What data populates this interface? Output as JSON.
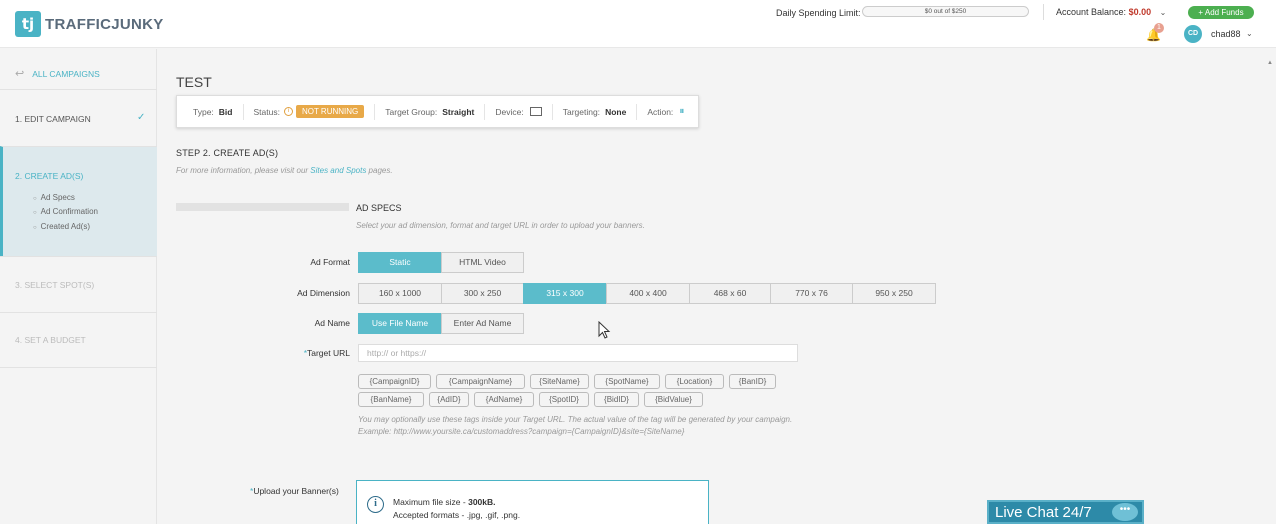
{
  "header": {
    "logo_mark": "tj",
    "logo_text": "TRAFFICJUNKY",
    "spending_label": "Daily Spending Limit:",
    "spending_bar_text": "$0 out of $250",
    "balance_label": "Account Balance:",
    "balance_value": "$0.00",
    "add_funds": "+ Add Funds",
    "notification_count": "1",
    "avatar_initials": "CD",
    "username": "chad88"
  },
  "sidebar": {
    "back_label": "ALL CAMPAIGNS",
    "steps": [
      {
        "label": "1. EDIT CAMPAIGN",
        "state": "done"
      },
      {
        "label": "2. CREATE AD(S)",
        "state": "active"
      },
      {
        "label": "3. SELECT SPOT(S)",
        "state": "disabled"
      },
      {
        "label": "4. SET A BUDGET",
        "state": "disabled"
      }
    ],
    "substeps": [
      "Ad Specs",
      "Ad Confirmation",
      "Created Ad(s)"
    ]
  },
  "main": {
    "title": "TEST",
    "info": {
      "type_label": "Type:",
      "type_value": "Bid",
      "status_label": "Status:",
      "status_value": "NOT RUNNING",
      "target_group_label": "Target Group:",
      "target_group_value": "Straight",
      "device_label": "Device:",
      "targeting_label": "Targeting:",
      "targeting_value": "None",
      "action_label": "Action:"
    },
    "step_heading": "STEP 2. CREATE AD(S)",
    "step_info_prefix": "For more information, please visit our ",
    "step_info_link": "Sites and Spots",
    "step_info_suffix": " pages.",
    "specs_title": "AD SPECS",
    "specs_subtitle": "Select your ad dimension, format and target URL in order to upload your banners.",
    "ad_format_label": "Ad Format",
    "ad_formats": [
      "Static",
      "HTML Video"
    ],
    "ad_dimension_label": "Ad Dimension",
    "ad_dimensions": [
      "160 x 1000",
      "300 x 250",
      "315 x 300",
      "400 x 400",
      "468 x 60",
      "770 x 76",
      "950 x 250"
    ],
    "ad_name_label": "Ad Name",
    "ad_name_options": [
      "Use File Name",
      "Enter Ad Name"
    ],
    "target_url_label": "Target URL",
    "target_url_placeholder": "http:// or https://",
    "tags": [
      "{CampaignID}",
      "{CampaignName}",
      "{SiteName}",
      "{SpotName}",
      "{Location}",
      "{BanID}",
      "{BanName}",
      "{AdID}",
      "{AdName}",
      "{SpotID}",
      "{BidID}",
      "{BidValue}"
    ],
    "tag_help_line1": "You may optionally use these tags inside your Target URL. The actual value of the tag will be generated by your campaign.",
    "tag_help_line2": "Example: http://www.yoursite.ca/customaddress?campaign={CampaignID}&site={SiteName}",
    "upload_label": "Upload your Banner(s)",
    "upload_max_label": "Maximum file size - ",
    "upload_max_value": "300kB.",
    "upload_formats": "Accepted formats - .jpg, .gif, .png."
  },
  "live_chat": "Live Chat 24/7",
  "colors": {
    "accent": "#4ab3c5",
    "status": "#e8a948",
    "add_funds": "#4caf50"
  }
}
